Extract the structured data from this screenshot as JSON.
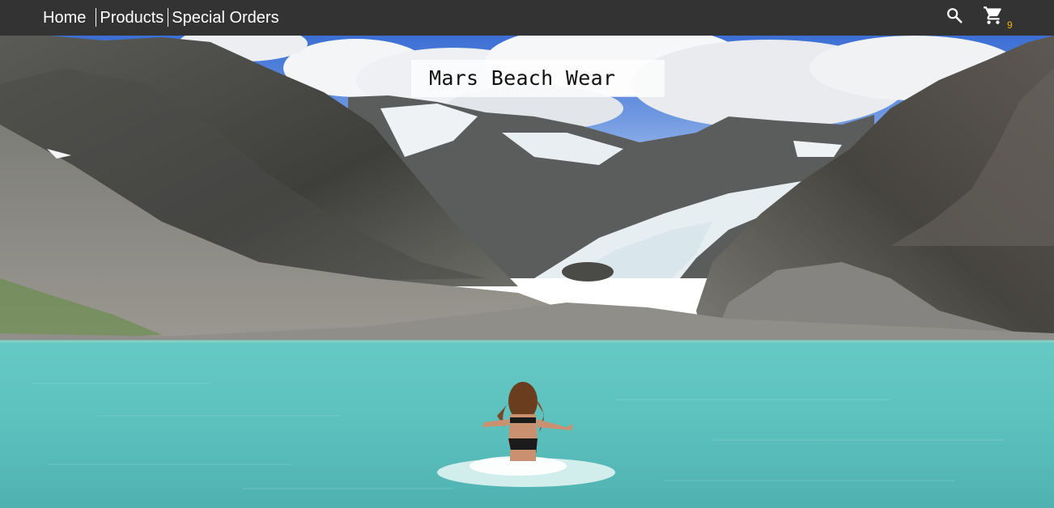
{
  "nav": {
    "links": [
      {
        "label": "Home"
      },
      {
        "label": "Products"
      },
      {
        "label": "Special Orders"
      }
    ],
    "search_icon": "search-icon",
    "cart_icon": "shopping-cart-icon",
    "cart_count": "9"
  },
  "hero": {
    "title": "Mars Beach Wear",
    "image": "woman-wading-into-turquoise-glacier-lake-with-snowy-mountains"
  },
  "colors": {
    "navbar_bg": "#333333",
    "nav_text": "#ffffff",
    "cart_badge": "#f5b400",
    "lake": "#5cc4c0"
  }
}
